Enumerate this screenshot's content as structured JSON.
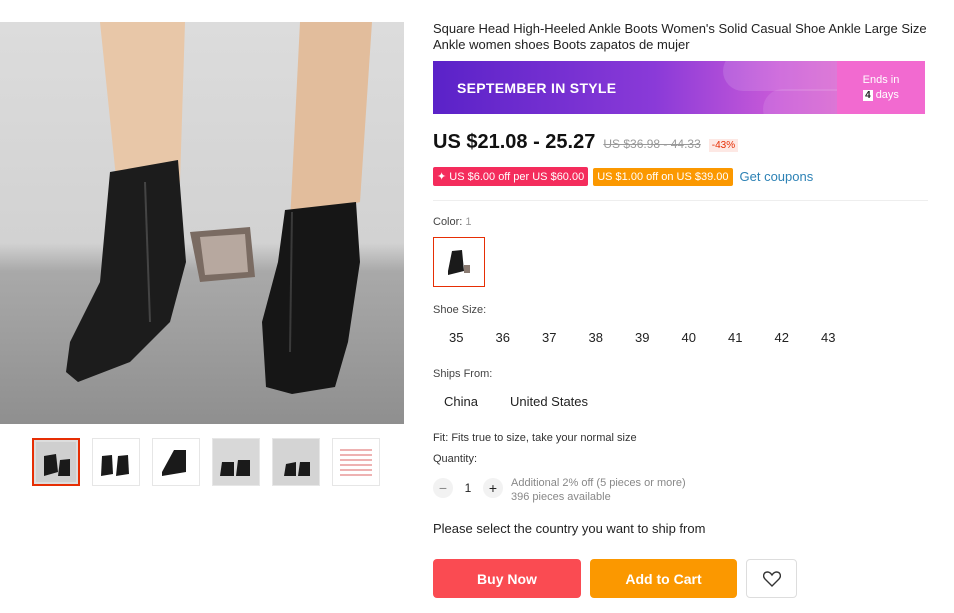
{
  "product": {
    "title": "Square Head High-Heeled Ankle Boots Women's Solid Casual Shoe Ankle Large Size Ankle women shoes Boots zapatos de mujer"
  },
  "banner": {
    "text": "SEPTEMBER IN STYLE",
    "ends_in_label": "Ends in",
    "days_count": "4",
    "days_label": "days"
  },
  "price": {
    "current": "US $21.08 - 25.27",
    "original": "US $36.98 - 44.33",
    "discount": "-43%"
  },
  "coupons": {
    "store_coupon": "✦ US $6.00 off per US $60.00",
    "select_coupon": "US $1.00 off on US $39.00",
    "get_coupons": "Get coupons"
  },
  "color": {
    "label": "Color:",
    "count": "1"
  },
  "shoe_size": {
    "label": "Shoe Size:",
    "options": [
      "35",
      "36",
      "37",
      "38",
      "39",
      "40",
      "41",
      "42",
      "43"
    ]
  },
  "ships_from": {
    "label": "Ships From:",
    "options": [
      "China",
      "United States"
    ]
  },
  "fit": "Fit: Fits true to size, take your normal size",
  "quantity": {
    "label": "Quantity:",
    "value": "1",
    "minus": "−",
    "plus": "+",
    "additional": "Additional 2% off (5 pieces or more)",
    "available": "396 pieces available"
  },
  "ship_note": "Please select the country you want to ship from",
  "actions": {
    "buy_now": "Buy Now",
    "add_to_cart": "Add to Cart"
  },
  "colors": {
    "accent_red": "#fa4b52",
    "accent_orange": "#fb9800",
    "link_blue": "#2d82b5"
  }
}
